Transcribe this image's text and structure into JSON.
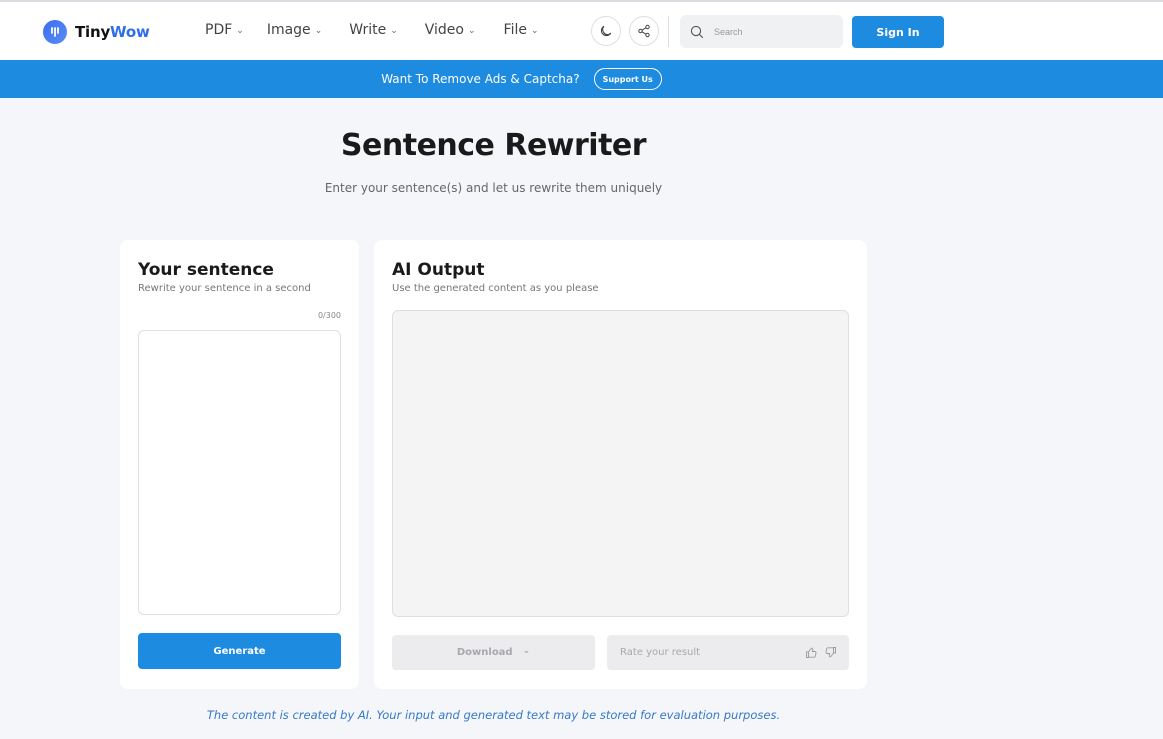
{
  "brand": {
    "name_part1": "Tiny",
    "name_part2": "Wow",
    "accent": "#2f6ee8"
  },
  "nav": {
    "menu": [
      {
        "label": "PDF"
      },
      {
        "label": "Image"
      },
      {
        "label": "Write"
      },
      {
        "label": "Video"
      },
      {
        "label": "File"
      }
    ],
    "theme_icon": "moon-icon",
    "share_icon": "share-icon",
    "search_placeholder": "Search",
    "signin_label": "Sign In"
  },
  "banner": {
    "text": "Want To Remove Ads & Captcha?",
    "button_label": "Support Us",
    "color": "#1d8be0"
  },
  "page": {
    "title": "Sentence Rewriter",
    "subtitle": "Enter your sentence(s) and let us rewrite them uniquely"
  },
  "input_card": {
    "title": "Your sentence",
    "subtitle": "Rewrite your sentence in a second",
    "counter": "0/300",
    "value": "",
    "generate_label": "Generate"
  },
  "output_card": {
    "title": "AI Output",
    "subtitle": "Use the generated content as you please",
    "download_label": "Download",
    "rate_label": "Rate your result"
  },
  "disclaimer": "The content is created by AI. Your input and generated text may be stored for evaluation purposes."
}
